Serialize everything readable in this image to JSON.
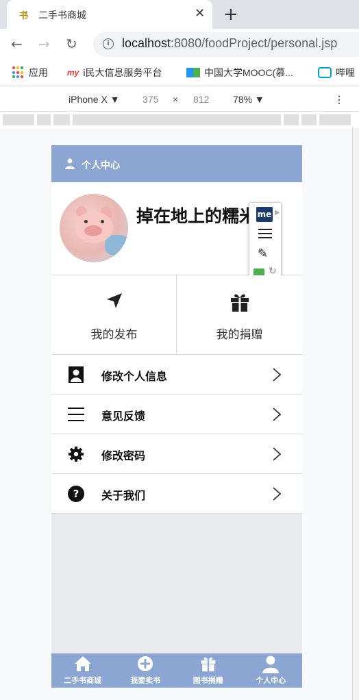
{
  "browser": {
    "tab_title": "二手书商城",
    "tab_favicon": "书",
    "url_host": "localhost",
    "url_path": ":8080/foodProject/personal.jsp",
    "bookmarks": [
      {
        "label": "应用"
      },
      {
        "icon_text": "my",
        "label": "i民大信息服务平台"
      },
      {
        "label": "中国大学MOOC(慕..."
      },
      {
        "label": "哔哩"
      }
    ]
  },
  "devtools": {
    "device": "iPhone X ▼",
    "width": "375",
    "times": "×",
    "height": "812",
    "zoom": "78% ▼"
  },
  "page": {
    "header_title": "个人中心",
    "nickname": "掉在地上的糯米饭",
    "ext_badge": "me",
    "actions": [
      {
        "label": "我的发布",
        "icon": "send-arrow-icon"
      },
      {
        "label": "我的捐赠",
        "icon": "gift-icon"
      }
    ],
    "menu": [
      {
        "label": "修改个人信息",
        "icon": "user-card-icon"
      },
      {
        "label": "意见反馈",
        "icon": "list-lines-icon"
      },
      {
        "label": "修改密码",
        "icon": "gear-icon"
      },
      {
        "label": "关于我们",
        "icon": "question-circle-icon"
      }
    ],
    "bottom_tabs": [
      {
        "label": "二手书商城",
        "icon": "home-icon"
      },
      {
        "label": "我要卖书",
        "icon": "plus-circle-icon"
      },
      {
        "label": "图书捐赠",
        "icon": "gift-icon"
      },
      {
        "label": "个人中心",
        "icon": "person-icon"
      }
    ]
  },
  "colors": {
    "header": "#8ba6d3",
    "background": "#e9eaee"
  }
}
